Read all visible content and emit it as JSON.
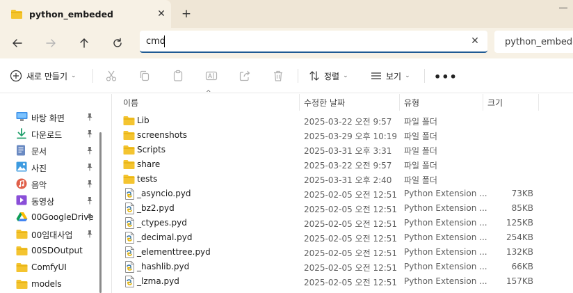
{
  "window": {
    "tab_title": "python_embeded",
    "tab_close": "✕",
    "new_tab": "+"
  },
  "nav": {
    "address_value": "cmd",
    "clear": "✕",
    "breadcrumb": "python_embeded"
  },
  "toolbar": {
    "new_label": "새로 만들기",
    "sort_label": "정렬",
    "view_label": "보기",
    "more": "•••"
  },
  "sidebar": {
    "items": [
      {
        "label": "바탕 화면",
        "icon": "desktop-icon",
        "pinned": true
      },
      {
        "label": "다운로드",
        "icon": "download-icon",
        "pinned": true
      },
      {
        "label": "문서",
        "icon": "document-icon",
        "pinned": true
      },
      {
        "label": "사진",
        "icon": "pictures-icon",
        "pinned": true
      },
      {
        "label": "음악",
        "icon": "music-icon",
        "pinned": true
      },
      {
        "label": "동영상",
        "icon": "video-icon",
        "pinned": true
      },
      {
        "label": "00GoogleDrive",
        "icon": "google-drive-icon",
        "pinned": true
      },
      {
        "label": "00임대사업",
        "icon": "folder-icon",
        "pinned": true
      },
      {
        "label": "00SDOutput",
        "icon": "folder-icon",
        "pinned": false
      },
      {
        "label": "ComfyUI",
        "icon": "folder-icon",
        "pinned": false
      },
      {
        "label": "models",
        "icon": "folder-icon",
        "pinned": false
      }
    ]
  },
  "columns": {
    "name": "이름",
    "date": "수정한 날짜",
    "type": "유형",
    "size": "크기"
  },
  "files": [
    {
      "name": "Lib",
      "date": "2025-03-22 오전 9:57",
      "type": "파일 폴더",
      "size": "",
      "kind": "folder"
    },
    {
      "name": "screenshots",
      "date": "2025-03-29 오후 10:19",
      "type": "파일 폴더",
      "size": "",
      "kind": "folder"
    },
    {
      "name": "Scripts",
      "date": "2025-03-31 오후 3:31",
      "type": "파일 폴더",
      "size": "",
      "kind": "folder"
    },
    {
      "name": "share",
      "date": "2025-03-22 오전 9:57",
      "type": "파일 폴더",
      "size": "",
      "kind": "folder"
    },
    {
      "name": "tests",
      "date": "2025-03-31 오후 2:40",
      "type": "파일 폴더",
      "size": "",
      "kind": "folder"
    },
    {
      "name": "_asyncio.pyd",
      "date": "2025-02-05 오전 12:51",
      "type": "Python Extension ...",
      "size": "73KB",
      "kind": "pyd"
    },
    {
      "name": "_bz2.pyd",
      "date": "2025-02-05 오전 12:51",
      "type": "Python Extension ...",
      "size": "85KB",
      "kind": "pyd"
    },
    {
      "name": "_ctypes.pyd",
      "date": "2025-02-05 오전 12:51",
      "type": "Python Extension ...",
      "size": "125KB",
      "kind": "pyd"
    },
    {
      "name": "_decimal.pyd",
      "date": "2025-02-05 오전 12:51",
      "type": "Python Extension ...",
      "size": "254KB",
      "kind": "pyd"
    },
    {
      "name": "_elementtree.pyd",
      "date": "2025-02-05 오전 12:51",
      "type": "Python Extension ...",
      "size": "132KB",
      "kind": "pyd"
    },
    {
      "name": "_hashlib.pyd",
      "date": "2025-02-05 오전 12:51",
      "type": "Python Extension ...",
      "size": "66KB",
      "kind": "pyd"
    },
    {
      "name": "_lzma.pyd",
      "date": "2025-02-05 오전 12:51",
      "type": "Python Extension ...",
      "size": "157KB",
      "kind": "pyd"
    }
  ],
  "colors": {
    "folder": "#f4c430",
    "folder_dark": "#e0a800",
    "accent": "#1f5a93",
    "chrome": "#f7f1e5"
  }
}
